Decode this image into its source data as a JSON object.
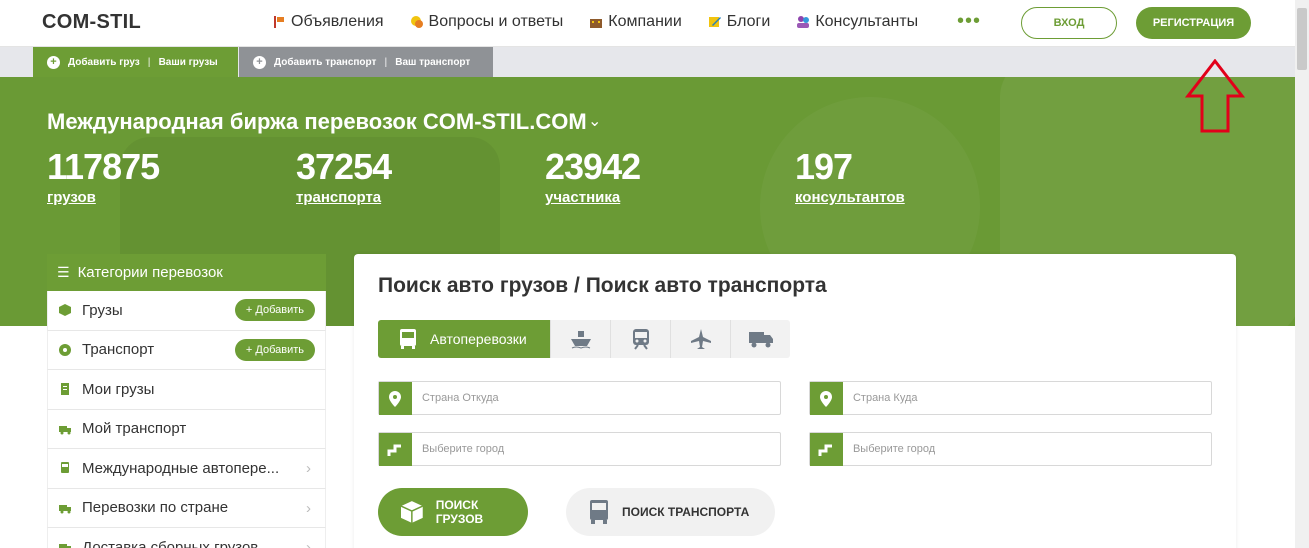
{
  "header": {
    "logo": "COM-STIL",
    "nav": [
      {
        "label": "Объявления",
        "icon": "flag-icon"
      },
      {
        "label": "Вопросы и ответы",
        "icon": "chat-icon"
      },
      {
        "label": "Компании",
        "icon": "building-icon"
      },
      {
        "label": "Блоги",
        "icon": "pencil-icon"
      },
      {
        "label": "Консультанты",
        "icon": "people-icon"
      }
    ],
    "more": "•••",
    "login_label": "ВХОД",
    "register_label": "РЕГИСТРАЦИЯ"
  },
  "subbar": {
    "add_cargo": "Добавить груз",
    "your_cargo": "Ваши грузы",
    "add_transport": "Добавить транспорт",
    "your_transport": "Ваш транспорт"
  },
  "hero": {
    "title": "Международная биржа перевозок COM-STIL.COM",
    "stats": [
      {
        "value": "117875",
        "label": "грузов"
      },
      {
        "value": "37254",
        "label": "транспорта"
      },
      {
        "value": "23942",
        "label": "участника"
      },
      {
        "value": "197",
        "label": "консультантов"
      }
    ]
  },
  "sidebar": {
    "heading": "Категории перевозок",
    "items": [
      {
        "label": "Грузы",
        "add": "+ Добавить"
      },
      {
        "label": "Транспорт",
        "add": "+ Добавить"
      },
      {
        "label": "Мои грузы"
      },
      {
        "label": "Мой транспорт"
      },
      {
        "label": "Международные автопере..."
      },
      {
        "label": "Перевозки по стране"
      },
      {
        "label": "Доставка сборных грузов"
      }
    ]
  },
  "search": {
    "title": "Поиск авто грузов / Поиск авто транспорта",
    "mode_active": "Автоперевозки",
    "from_country_placeholder": "Страна Откуда",
    "to_country_placeholder": "Страна Куда",
    "from_city_placeholder": "Выберите город",
    "to_city_placeholder": "Выберите город",
    "search_cargo_label": "ПОИСК ГРУЗОВ",
    "search_transport_label": "ПОИСК ТРАНСПОРТА"
  },
  "colors": {
    "brand_green": "#6d9d35",
    "arrow_red": "#e2001a"
  }
}
